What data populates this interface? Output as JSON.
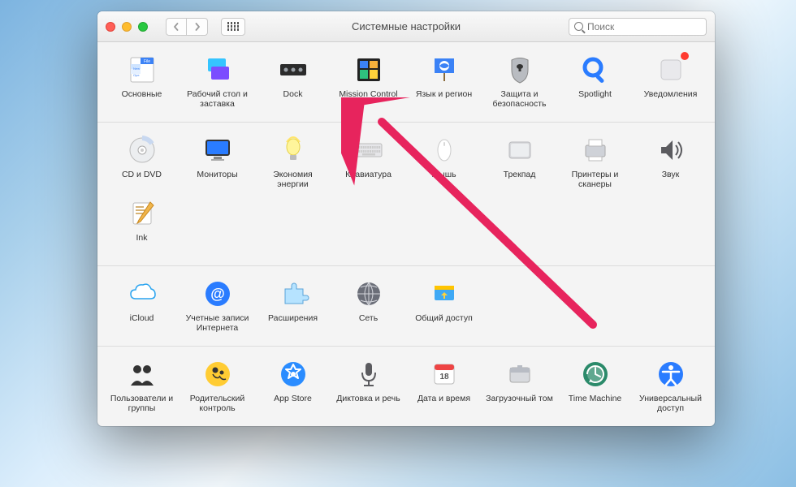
{
  "window": {
    "title": "Системные настройки"
  },
  "search": {
    "placeholder": "Поиск"
  },
  "sections": [
    {
      "items": [
        {
          "id": "general",
          "label": "Основные"
        },
        {
          "id": "desktop",
          "label": "Рабочий стол и заставка"
        },
        {
          "id": "dock",
          "label": "Dock"
        },
        {
          "id": "mission",
          "label": "Mission Control"
        },
        {
          "id": "language",
          "label": "Язык и регион"
        },
        {
          "id": "security",
          "label": "Защита и безопасность"
        },
        {
          "id": "spotlight",
          "label": "Spotlight"
        },
        {
          "id": "notifications",
          "label": "Уведомления",
          "badge": true
        }
      ]
    },
    {
      "items": [
        {
          "id": "cddvd",
          "label": "CD и DVD"
        },
        {
          "id": "displays",
          "label": "Мониторы"
        },
        {
          "id": "energy",
          "label": "Экономия энергии"
        },
        {
          "id": "keyboard",
          "label": "Клавиатура"
        },
        {
          "id": "mouse",
          "label": "Мышь"
        },
        {
          "id": "trackpad",
          "label": "Трекпад"
        },
        {
          "id": "printers",
          "label": "Принтеры и сканеры"
        },
        {
          "id": "sound",
          "label": "Звук"
        },
        {
          "id": "ink",
          "label": "Ink"
        }
      ]
    },
    {
      "items": [
        {
          "id": "icloud",
          "label": "iCloud"
        },
        {
          "id": "accounts",
          "label": "Учетные записи Интернета"
        },
        {
          "id": "extensions",
          "label": "Расширения"
        },
        {
          "id": "network",
          "label": "Сеть"
        },
        {
          "id": "sharing",
          "label": "Общий доступ"
        }
      ]
    },
    {
      "items": [
        {
          "id": "users",
          "label": "Пользователи и группы"
        },
        {
          "id": "parental",
          "label": "Родительский контроль"
        },
        {
          "id": "appstore",
          "label": "App Store"
        },
        {
          "id": "dictation",
          "label": "Диктовка и речь"
        },
        {
          "id": "datetime",
          "label": "Дата и время"
        },
        {
          "id": "startup",
          "label": "Загрузочный том"
        },
        {
          "id": "timemachine",
          "label": "Time Machine"
        },
        {
          "id": "accessibility",
          "label": "Универсальный доступ"
        }
      ]
    }
  ]
}
